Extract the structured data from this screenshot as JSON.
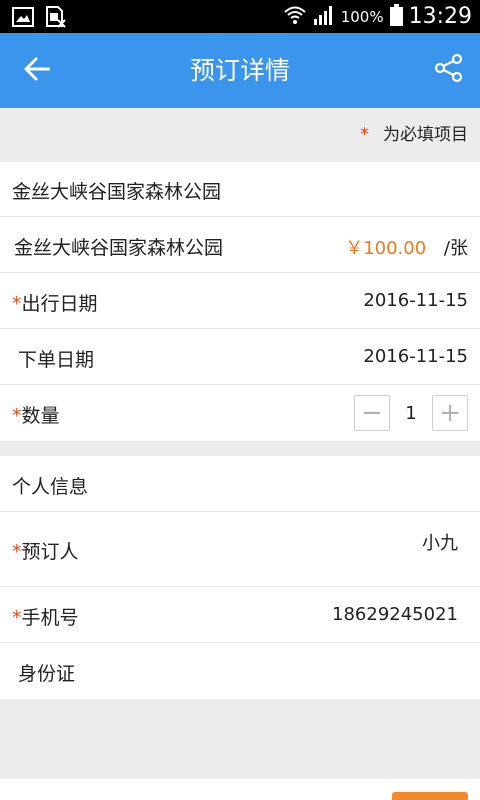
{
  "status_bar": {
    "battery_percent": "100%",
    "time": "13:29",
    "icons": [
      "screenshot-icon",
      "sim-card-icon",
      "wifi-icon",
      "signal-icon",
      "battery-icon"
    ]
  },
  "header": {
    "title": "预订详情",
    "back_icon": "back-arrow-icon",
    "share_icon": "share-icon",
    "background_color": "#3b95ec"
  },
  "required_note": {
    "star": "*",
    "text": "为必填项目"
  },
  "park": {
    "name": "金丝大峡谷国家森林公园"
  },
  "ticket": {
    "name": "金丝大峡谷国家森林公园",
    "price": "￥100.00",
    "unit": "/张"
  },
  "travel_date": {
    "star": "*",
    "label": "出行日期",
    "value": "2016-11-15"
  },
  "order_date": {
    "label": "下单日期",
    "value": "2016-11-15"
  },
  "quantity": {
    "star": "*",
    "label": "数量",
    "value": "1",
    "minus": "−",
    "plus": "+"
  },
  "personal": {
    "section_title": "个人信息",
    "booker_star": "*",
    "booker_label": "预订人",
    "booker_value": "小九",
    "phone_star": "*",
    "phone_label": "手机号",
    "phone_value": "18629245021",
    "id_label": "身份证",
    "id_value": ""
  },
  "colors": {
    "accent": "#3b95ec",
    "required": "#e8481c",
    "price": "#f0781e"
  }
}
